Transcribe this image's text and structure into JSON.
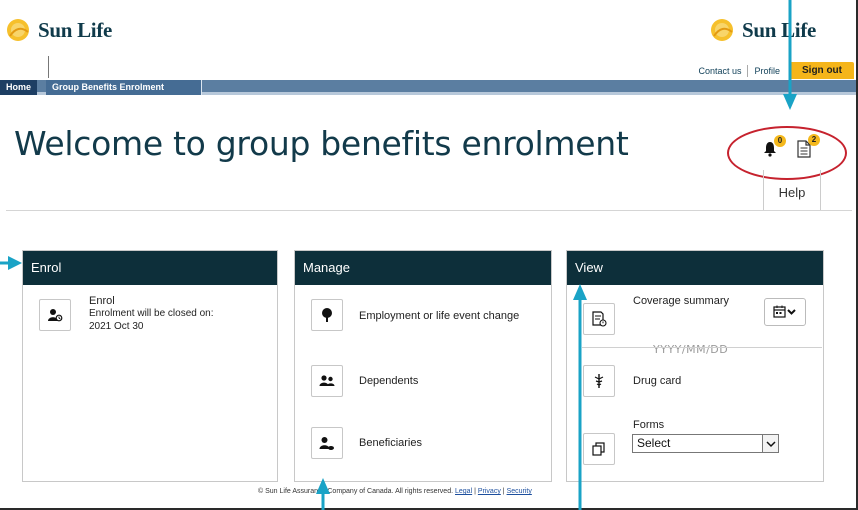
{
  "brand": {
    "left_name": "Sun Life",
    "right_name": "Sun Life",
    "logo_icon": "sun-logo-icon"
  },
  "top_links": {
    "contact": "Contact us",
    "profile": "Profile",
    "signout": "Sign out"
  },
  "nav": {
    "home": "Home",
    "group_benefits": "Group Benefits Enrolment"
  },
  "page": {
    "title": "Welcome to group benefits enrolment",
    "help": "Help"
  },
  "notifications": {
    "bell_count": "0",
    "docs_count": "2"
  },
  "cards": {
    "enrol": {
      "header": "Enrol",
      "item_title": "Enrol",
      "item_line1": "Enrolment will be closed on:",
      "item_line2": "2021 Oct 30"
    },
    "manage": {
      "header": "Manage",
      "items": [
        {
          "label": "Employment or life event change",
          "icon": "tree-icon"
        },
        {
          "label": "Dependents",
          "icon": "dependents-icon"
        },
        {
          "label": "Beneficiaries",
          "icon": "beneficiaries-icon"
        }
      ]
    },
    "view": {
      "header": "View",
      "coverage_title": "Coverage summary",
      "date_placeholder": "YYYY/MM/DD",
      "drug_card": "Drug card",
      "forms_title": "Forms",
      "forms_selected": "Select"
    }
  },
  "footer": {
    "copyright": "© Sun Life Assurance Company of Canada. All rights reserved.",
    "legal": "Legal",
    "privacy": "Privacy",
    "security": "Security",
    "sep": "|"
  },
  "colors": {
    "accent": "#f5b51a",
    "dark_header": "#0d2f3a",
    "nav_blue": "#5b7ea1",
    "annotation_teal": "#1aa3c6",
    "annotation_red": "#c6222e"
  }
}
